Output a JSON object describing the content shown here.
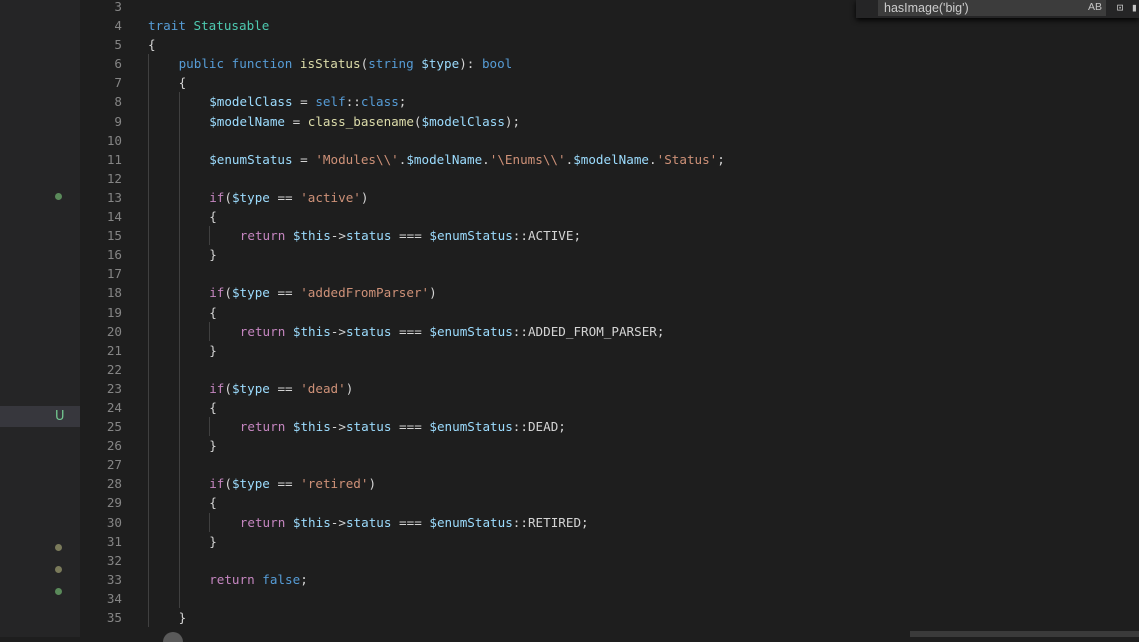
{
  "find_widget": {
    "query": "hasImage('big')",
    "match_case_label": "AB",
    "toggle_icon_a": "regex-icon",
    "toggle_icon_b": "word-icon"
  },
  "scm": {
    "untracked_letter": "U",
    "colors": {
      "modified_dot": "#5a8a5a",
      "moved_dot": "#7a7a5a",
      "untracked": "#73c991"
    }
  },
  "colors": {
    "background": "#1e1e1e",
    "sidebar": "#252526",
    "keyword": "#569cd6",
    "control": "#c586c0",
    "function": "#dcdcaa",
    "variable": "#9cdcfe",
    "string": "#ce9178",
    "type": "#4ec9b0",
    "text": "#d4d4d4",
    "line_number": "#858585"
  },
  "code": {
    "lines": [
      {
        "n": "3",
        "indent": 0,
        "tokens": []
      },
      {
        "n": "4",
        "indent": 0,
        "tokens": [
          [
            "kw",
            "trait "
          ],
          [
            "ty",
            "Statusable"
          ]
        ]
      },
      {
        "n": "5",
        "indent": 0,
        "tokens": [
          [
            "plain",
            "{"
          ]
        ]
      },
      {
        "n": "6",
        "indent": 1,
        "tokens": [
          [
            "kw",
            "public "
          ],
          [
            "kw",
            "function "
          ],
          [
            "fn",
            "isStatus"
          ],
          [
            "plain",
            "("
          ],
          [
            "kw",
            "string "
          ],
          [
            "var",
            "$type"
          ],
          [
            "plain",
            "): "
          ],
          [
            "kw",
            "bool"
          ]
        ]
      },
      {
        "n": "7",
        "indent": 1,
        "tokens": [
          [
            "plain",
            "{"
          ]
        ]
      },
      {
        "n": "8",
        "indent": 2,
        "tokens": [
          [
            "var",
            "$modelClass"
          ],
          [
            "plain",
            " = "
          ],
          [
            "kw",
            "self"
          ],
          [
            "plain",
            "::"
          ],
          [
            "kw",
            "class"
          ],
          [
            "plain",
            ";"
          ]
        ]
      },
      {
        "n": "9",
        "indent": 2,
        "tokens": [
          [
            "var",
            "$modelName"
          ],
          [
            "plain",
            " = "
          ],
          [
            "fn",
            "class_basename"
          ],
          [
            "plain",
            "("
          ],
          [
            "var",
            "$modelClass"
          ],
          [
            "plain",
            ");"
          ]
        ]
      },
      {
        "n": "10",
        "indent": 2,
        "tokens": []
      },
      {
        "n": "11",
        "indent": 2,
        "tokens": [
          [
            "var",
            "$enumStatus"
          ],
          [
            "plain",
            " = "
          ],
          [
            "str",
            "'Modules\\\\'"
          ],
          [
            "plain",
            "."
          ],
          [
            "var",
            "$modelName"
          ],
          [
            "plain",
            "."
          ],
          [
            "str",
            "'\\Enums\\\\'"
          ],
          [
            "plain",
            "."
          ],
          [
            "var",
            "$modelName"
          ],
          [
            "plain",
            "."
          ],
          [
            "str",
            "'Status'"
          ],
          [
            "plain",
            ";"
          ]
        ]
      },
      {
        "n": "12",
        "indent": 2,
        "tokens": []
      },
      {
        "n": "13",
        "indent": 2,
        "tokens": [
          [
            "ctl",
            "if"
          ],
          [
            "plain",
            "("
          ],
          [
            "var",
            "$type"
          ],
          [
            "plain",
            " == "
          ],
          [
            "str",
            "'active'"
          ],
          [
            "plain",
            ")"
          ]
        ]
      },
      {
        "n": "14",
        "indent": 2,
        "tokens": [
          [
            "plain",
            "{"
          ]
        ]
      },
      {
        "n": "15",
        "indent": 3,
        "tokens": [
          [
            "ctl",
            "return "
          ],
          [
            "var",
            "$this"
          ],
          [
            "plain",
            "->"
          ],
          [
            "var",
            "status"
          ],
          [
            "plain",
            " === "
          ],
          [
            "var",
            "$enumStatus"
          ],
          [
            "plain",
            "::ACTIVE;"
          ]
        ]
      },
      {
        "n": "16",
        "indent": 2,
        "tokens": [
          [
            "plain",
            "}"
          ]
        ]
      },
      {
        "n": "17",
        "indent": 2,
        "tokens": []
      },
      {
        "n": "18",
        "indent": 2,
        "tokens": [
          [
            "ctl",
            "if"
          ],
          [
            "plain",
            "("
          ],
          [
            "var",
            "$type"
          ],
          [
            "plain",
            " == "
          ],
          [
            "str",
            "'addedFromParser'"
          ],
          [
            "plain",
            ")"
          ]
        ]
      },
      {
        "n": "19",
        "indent": 2,
        "tokens": [
          [
            "plain",
            "{"
          ]
        ]
      },
      {
        "n": "20",
        "indent": 3,
        "tokens": [
          [
            "ctl",
            "return "
          ],
          [
            "var",
            "$this"
          ],
          [
            "plain",
            "->"
          ],
          [
            "var",
            "status"
          ],
          [
            "plain",
            " === "
          ],
          [
            "var",
            "$enumStatus"
          ],
          [
            "plain",
            "::ADDED_FROM_PARSER;"
          ]
        ]
      },
      {
        "n": "21",
        "indent": 2,
        "tokens": [
          [
            "plain",
            "}"
          ]
        ]
      },
      {
        "n": "22",
        "indent": 2,
        "tokens": []
      },
      {
        "n": "23",
        "indent": 2,
        "tokens": [
          [
            "ctl",
            "if"
          ],
          [
            "plain",
            "("
          ],
          [
            "var",
            "$type"
          ],
          [
            "plain",
            " == "
          ],
          [
            "str",
            "'dead'"
          ],
          [
            "plain",
            ")"
          ]
        ]
      },
      {
        "n": "24",
        "indent": 2,
        "tokens": [
          [
            "plain",
            "{"
          ]
        ]
      },
      {
        "n": "25",
        "indent": 3,
        "tokens": [
          [
            "ctl",
            "return "
          ],
          [
            "var",
            "$this"
          ],
          [
            "plain",
            "->"
          ],
          [
            "var",
            "status"
          ],
          [
            "plain",
            " === "
          ],
          [
            "var",
            "$enumStatus"
          ],
          [
            "plain",
            "::DEAD;"
          ]
        ]
      },
      {
        "n": "26",
        "indent": 2,
        "tokens": [
          [
            "plain",
            "}"
          ]
        ]
      },
      {
        "n": "27",
        "indent": 2,
        "tokens": []
      },
      {
        "n": "28",
        "indent": 2,
        "tokens": [
          [
            "ctl",
            "if"
          ],
          [
            "plain",
            "("
          ],
          [
            "var",
            "$type"
          ],
          [
            "plain",
            " == "
          ],
          [
            "str",
            "'retired'"
          ],
          [
            "plain",
            ")"
          ]
        ]
      },
      {
        "n": "29",
        "indent": 2,
        "tokens": [
          [
            "plain",
            "{"
          ]
        ]
      },
      {
        "n": "30",
        "indent": 3,
        "tokens": [
          [
            "ctl",
            "return "
          ],
          [
            "var",
            "$this"
          ],
          [
            "plain",
            "->"
          ],
          [
            "var",
            "status"
          ],
          [
            "plain",
            " === "
          ],
          [
            "var",
            "$enumStatus"
          ],
          [
            "plain",
            "::RETIRED;"
          ]
        ]
      },
      {
        "n": "31",
        "indent": 2,
        "tokens": [
          [
            "plain",
            "}"
          ]
        ]
      },
      {
        "n": "32",
        "indent": 2,
        "tokens": []
      },
      {
        "n": "33",
        "indent": 2,
        "tokens": [
          [
            "ctl",
            "return "
          ],
          [
            "kw",
            "false"
          ],
          [
            "plain",
            ";"
          ]
        ]
      },
      {
        "n": "34",
        "indent": 2,
        "tokens": []
      },
      {
        "n": "35",
        "indent": 1,
        "tokens": [
          [
            "plain",
            "}"
          ]
        ]
      }
    ]
  }
}
